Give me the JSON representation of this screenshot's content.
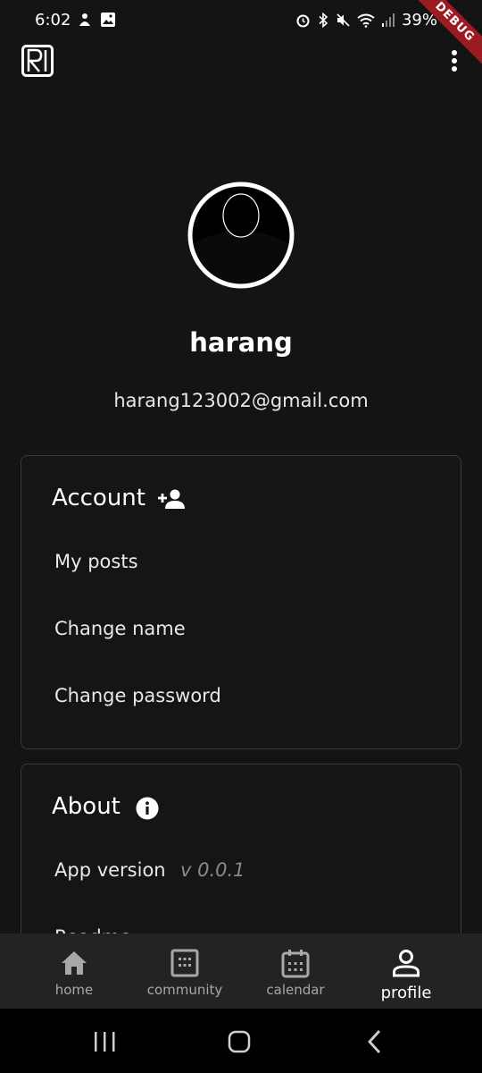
{
  "status_bar": {
    "time": "6:02",
    "battery": "39%",
    "debug_label": "DEBUG"
  },
  "profile": {
    "name": "harang",
    "email": "harang123002@gmail.com"
  },
  "account_section": {
    "title": "Account",
    "title_icon": "add-person-icon",
    "items": [
      {
        "label": "My posts"
      },
      {
        "label": "Change name"
      },
      {
        "label": "Change password"
      }
    ]
  },
  "about_section": {
    "title": "About",
    "title_icon": "info-icon",
    "app_version_label": "App version",
    "app_version_value": "v 0.0.1",
    "partial_item_label": "Readme"
  },
  "bottom_nav": {
    "items": [
      {
        "label": "home",
        "icon": "home-icon",
        "active": false
      },
      {
        "label": "community",
        "icon": "community-icon",
        "active": false
      },
      {
        "label": "calendar",
        "icon": "calendar-icon",
        "active": false
      },
      {
        "label": "profile",
        "icon": "person-icon",
        "active": true
      }
    ]
  },
  "colors": {
    "background": "#141414",
    "card_border": "#3a3a3a",
    "nav_background": "#232323",
    "muted_text": "#8a8a8a",
    "debug_ribbon": "#9c1a22"
  }
}
